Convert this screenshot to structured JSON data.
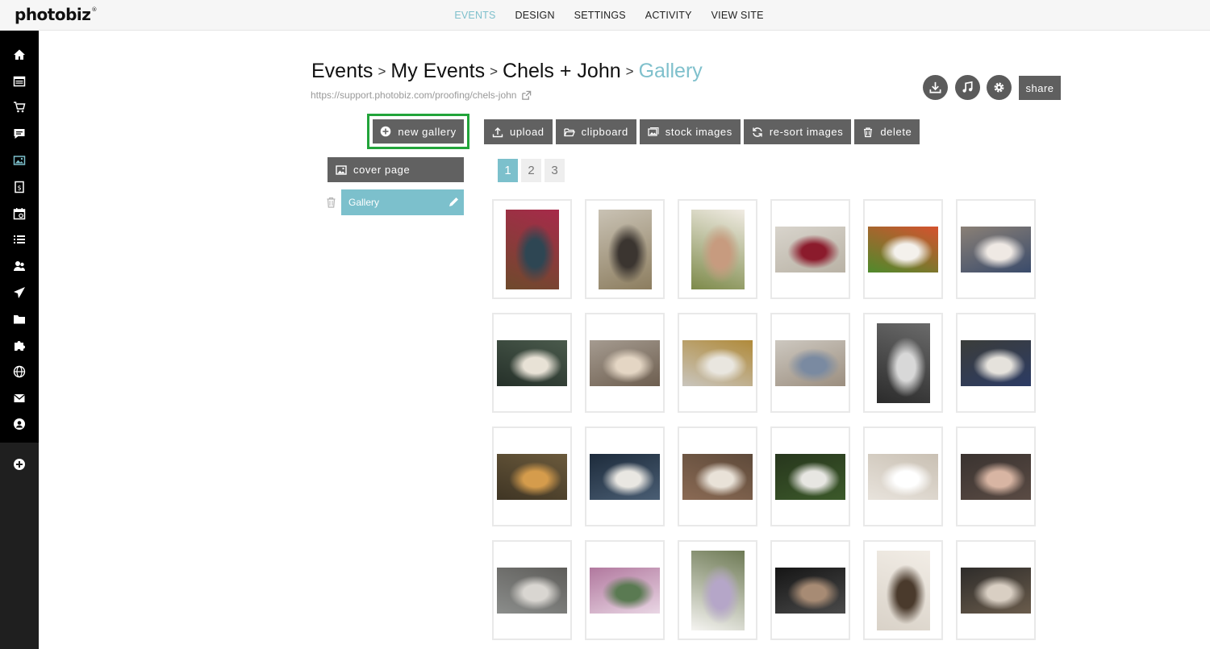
{
  "brand": {
    "logo": "photobiz",
    "mark": "®"
  },
  "topnav": [
    {
      "label": "EVENTS",
      "active": true
    },
    {
      "label": "DESIGN",
      "active": false
    },
    {
      "label": "SETTINGS",
      "active": false
    },
    {
      "label": "ACTIVITY",
      "active": false
    },
    {
      "label": "VIEW SITE",
      "active": false
    }
  ],
  "rail": {
    "icons": [
      "home-icon",
      "browser-icon",
      "cart-icon",
      "comment-icon",
      "images-icon",
      "invoice-icon",
      "calendar-icon",
      "list-icon",
      "clients-icon",
      "send-icon",
      "folder-icon",
      "puzzle-icon",
      "globe-icon",
      "mail-icon",
      "user-icon"
    ],
    "add_icon": "plus-circle-icon"
  },
  "breadcrumb": {
    "items": [
      "Events",
      "My Events",
      "Chels + John"
    ],
    "separator": ">",
    "current": "Gallery",
    "url": "https://support.photobiz.com/proofing/chels-john"
  },
  "tools": {
    "share_label": "share",
    "icons": [
      "download-icon",
      "music-icon",
      "gear-icon"
    ]
  },
  "new_gallery_label": "new gallery",
  "toolbar": {
    "upload": "upload",
    "clipboard": "clipboard",
    "stock": "stock images",
    "resort": "re-sort images",
    "delete": "delete"
  },
  "sidebar": {
    "cover_label": "cover page",
    "gallery_label": "Gallery"
  },
  "pagination": {
    "pages": [
      "1",
      "2",
      "3"
    ],
    "current": "1"
  },
  "colors": {
    "accent": "#7cc0cc",
    "button": "#616161",
    "highlight": "#22a43a",
    "rail": "#000000"
  },
  "thumbnails": [
    {
      "orientation": "portrait",
      "tones": [
        "#6e4a2c",
        "#2e4653",
        "#a72a4a"
      ]
    },
    {
      "orientation": "portrait",
      "tones": [
        "#c9c2b4",
        "#3b3530",
        "#8c7d5f"
      ]
    },
    {
      "orientation": "portrait",
      "tones": [
        "#7d8a4a",
        "#c79b7f",
        "#f1ece4"
      ]
    },
    {
      "orientation": "landscape",
      "tones": [
        "#d8d4cc",
        "#8b1b2c",
        "#b9b2a5"
      ]
    },
    {
      "orientation": "landscape",
      "tones": [
        "#4f8a2c",
        "#f4f1ec",
        "#d5522e"
      ]
    },
    {
      "orientation": "landscape",
      "tones": [
        "#8a8076",
        "#efe9e4",
        "#3a4b6b"
      ]
    },
    {
      "orientation": "landscape",
      "tones": [
        "#253029",
        "#e8e2d6",
        "#4a5a4c"
      ]
    },
    {
      "orientation": "landscape",
      "tones": [
        "#a59b90",
        "#e4d6c4",
        "#6d5e4f"
      ]
    },
    {
      "orientation": "landscape",
      "tones": [
        "#c9c5bd",
        "#e9e6df",
        "#b08a3a"
      ]
    },
    {
      "orientation": "landscape",
      "tones": [
        "#cdc8c0",
        "#7a8aa1",
        "#9b8e7f"
      ]
    },
    {
      "orientation": "portrait",
      "tones": [
        "#2b2b2b",
        "#d8d8d8",
        "#6a6a6a"
      ]
    },
    {
      "orientation": "landscape",
      "tones": [
        "#3b3d3a",
        "#e5e2dc",
        "#2c3b64"
      ]
    },
    {
      "orientation": "landscape",
      "tones": [
        "#3f3524",
        "#d59c4c",
        "#6b5a3c"
      ]
    },
    {
      "orientation": "landscape",
      "tones": [
        "#1d2b3b",
        "#e9e7e2",
        "#4a5e74"
      ]
    },
    {
      "orientation": "landscape",
      "tones": [
        "#8a6a54",
        "#e9e2d8",
        "#5e4a3a"
      ]
    },
    {
      "orientation": "landscape",
      "tones": [
        "#27361d",
        "#e7e6e2",
        "#3c5a2a"
      ]
    },
    {
      "orientation": "landscape",
      "tones": [
        "#e8e3dc",
        "#ffffff",
        "#c9c0b3"
      ]
    },
    {
      "orientation": "landscape",
      "tones": [
        "#3a3330",
        "#d8b5a3",
        "#5a4b44"
      ]
    },
    {
      "orientation": "landscape",
      "tones": [
        "#8b8d8b",
        "#d9d6d1",
        "#5e5d5a"
      ]
    },
    {
      "orientation": "landscape",
      "tones": [
        "#b1789e",
        "#5a7a52",
        "#e9d6e4"
      ]
    },
    {
      "orientation": "portrait",
      "tones": [
        "#f5f4f1",
        "#b5a6c8",
        "#6e7a55"
      ]
    },
    {
      "orientation": "landscape",
      "tones": [
        "#151515",
        "#a78b74",
        "#4a4a4a"
      ]
    },
    {
      "orientation": "portrait",
      "tones": [
        "#d9d2c8",
        "#4a3a2c",
        "#f2ede6"
      ]
    },
    {
      "orientation": "landscape",
      "tones": [
        "#2e2c2a",
        "#d9cfc3",
        "#6a5c4c"
      ]
    }
  ]
}
